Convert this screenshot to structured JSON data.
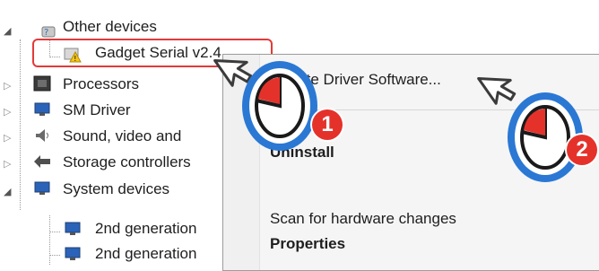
{
  "tree": {
    "items": [
      {
        "label": "Other devices",
        "icon": "other-devices-icon",
        "expander": "expanded"
      },
      {
        "label": "Gadget Serial v2.4",
        "icon": "warning-device-icon"
      },
      {
        "label": "Processors",
        "icon": "processor-icon",
        "expander": "collapsed"
      },
      {
        "label": "SM Driver",
        "icon": "computer-icon",
        "expander": "collapsed"
      },
      {
        "label": "Sound, video and",
        "icon": "speaker-icon",
        "expander": "collapsed"
      },
      {
        "label": "Storage controllers",
        "icon": "storage-icon",
        "expander": "collapsed"
      },
      {
        "label": "System devices",
        "icon": "computer-icon",
        "expander": "expanded"
      },
      {
        "label": "2nd generation",
        "icon": "computer-icon"
      },
      {
        "label": "2nd generation",
        "icon": "computer-icon"
      }
    ]
  },
  "context_menu": {
    "items": [
      {
        "label": "Update Driver Software..."
      },
      {
        "label": "Uninstall"
      },
      {
        "label": "Scan for hardware changes"
      },
      {
        "label": "Properties"
      }
    ]
  },
  "annotations": {
    "step1": "1",
    "step2": "2"
  },
  "colors": {
    "highlight": "#e23a3a",
    "badge": "#e4322b",
    "mouse_ring": "#2a78d4"
  }
}
